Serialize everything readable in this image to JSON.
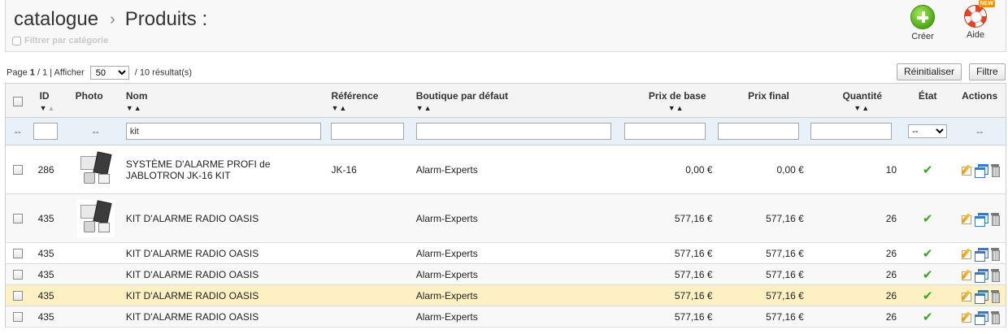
{
  "header": {
    "breadcrumb_root": "catalogue",
    "breadcrumb_sep": "›",
    "page_title": "Produits :",
    "filter_by_category": "Filtrer par catégorie",
    "create_label": "Créer",
    "help_label": "Aide",
    "help_badge": "NEW"
  },
  "pager": {
    "page_prefix": "Page",
    "page_current": "1",
    "page_total": "/ 1 | Afficher",
    "per_page": "50",
    "results": "/ 10 résultat(s)"
  },
  "buttons": {
    "reset": "Réinitialiser",
    "filter": "Filtre"
  },
  "columns": {
    "id": "ID",
    "photo": "Photo",
    "name": "Nom",
    "reference": "Référence",
    "shop": "Boutique par défaut",
    "base_price": "Prix de base",
    "final_price": "Prix final",
    "quantity": "Quantité",
    "state": "État",
    "actions": "Actions"
  },
  "filters": {
    "placeholder_dash": "--",
    "name_value": "kit",
    "state_value": "--"
  },
  "rows": [
    {
      "id": "286",
      "name": "SYSTÈME D'ALARME PROFI de JABLOTRON JK-16 KIT",
      "reference": "JK-16",
      "shop": "Alarm-Experts",
      "base_price": "0,00 €",
      "final_price": "0,00 €",
      "quantity": "10",
      "active": true,
      "has_photo": true,
      "style": "normal"
    },
    {
      "id": "435",
      "name": "KIT D'ALARME RADIO OASIS",
      "reference": "",
      "shop": "Alarm-Experts",
      "base_price": "577,16 €",
      "final_price": "577,16 €",
      "quantity": "26",
      "active": true,
      "has_photo": true,
      "style": "alt"
    },
    {
      "id": "435",
      "name": "KIT D'ALARME RADIO OASIS",
      "reference": "",
      "shop": "Alarm-Experts",
      "base_price": "577,16 €",
      "final_price": "577,16 €",
      "quantity": "26",
      "active": true,
      "has_photo": false,
      "style": "normal"
    },
    {
      "id": "435",
      "name": "KIT D'ALARME RADIO OASIS",
      "reference": "",
      "shop": "Alarm-Experts",
      "base_price": "577,16 €",
      "final_price": "577,16 €",
      "quantity": "26",
      "active": true,
      "has_photo": false,
      "style": "alt"
    },
    {
      "id": "435",
      "name": "KIT D'ALARME RADIO OASIS",
      "reference": "",
      "shop": "Alarm-Experts",
      "base_price": "577,16 €",
      "final_price": "577,16 €",
      "quantity": "26",
      "active": true,
      "has_photo": false,
      "style": "highlight"
    },
    {
      "id": "435",
      "name": "KIT D'ALARME RADIO OASIS",
      "reference": "",
      "shop": "Alarm-Experts",
      "base_price": "577,16 €",
      "final_price": "577,16 €",
      "quantity": "26",
      "active": true,
      "has_photo": false,
      "style": "alt"
    }
  ],
  "icons": {
    "active": "check-icon",
    "edit": "pencil-icon",
    "duplicate": "duplicate-icon",
    "delete": "trash-icon"
  },
  "colors": {
    "highlight_row": "#fdf1c3",
    "filter_row": "#e9f1f8",
    "active_check": "#3aa623"
  }
}
